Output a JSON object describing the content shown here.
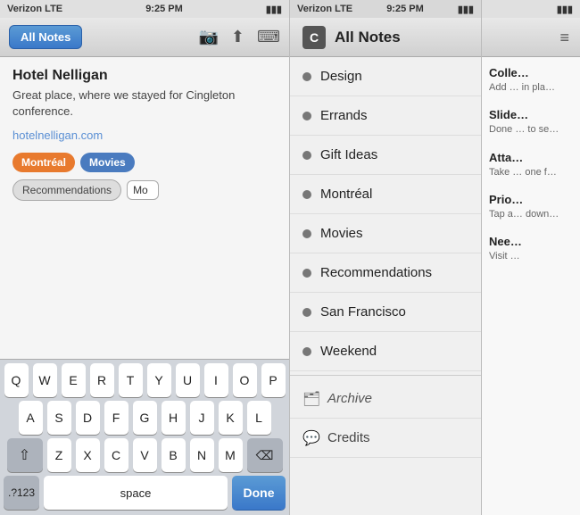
{
  "left": {
    "status": {
      "carrier": "Verizon LTE",
      "time": "9:25 PM",
      "battery": "▮▮▮"
    },
    "toolbar": {
      "back_label": "All Notes",
      "icons": [
        "camera",
        "share",
        "keyboard"
      ]
    },
    "note": {
      "title": "Hotel Nelligan",
      "body": "Great place, where we stayed for Cingleton conference.",
      "link": "hotelnelligan.com",
      "tags_row1": [
        "Montréal",
        "Movies"
      ],
      "tags_row2_outline": "Recommendations",
      "tag_input": "Mo"
    },
    "keyboard": {
      "row1": [
        "Q",
        "W",
        "E",
        "R",
        "T",
        "Y",
        "U",
        "I",
        "O",
        "P"
      ],
      "row2": [
        "A",
        "S",
        "D",
        "F",
        "G",
        "H",
        "J",
        "K",
        "L"
      ],
      "row3": [
        "Z",
        "X",
        "C",
        "V",
        "B",
        "N",
        "M"
      ],
      "num_label": ".?123",
      "space_label": "space",
      "done_label": "Done"
    }
  },
  "middle": {
    "status": {
      "carrier": "Verizon LTE",
      "time": "9:25 PM"
    },
    "header": {
      "logo": "C",
      "title": "All Notes"
    },
    "items": [
      {
        "label": "Design"
      },
      {
        "label": "Errands"
      },
      {
        "label": "Gift Ideas"
      },
      {
        "label": "Montréal"
      },
      {
        "label": "Movies"
      },
      {
        "label": "Recommendations"
      },
      {
        "label": "San Francisco"
      },
      {
        "label": "Weekend"
      }
    ],
    "special": [
      {
        "icon": "🗂",
        "label": "Archive"
      },
      {
        "icon": "💬",
        "label": "Credits"
      }
    ]
  },
  "right": {
    "status": {
      "battery": "▮▮▮"
    },
    "toolbar": {
      "menu_icon": "≡"
    },
    "items": [
      {
        "title": "Colle…",
        "body": "Add …\nin pla…"
      },
      {
        "title": "Slide…",
        "body": "Done …\nto se…"
      },
      {
        "title": "Atta…",
        "body": "Take …\none f…"
      },
      {
        "title": "Prio…",
        "body": "Tap a…\ndown…"
      },
      {
        "title": "Nee…",
        "body": "Visit …"
      }
    ]
  }
}
